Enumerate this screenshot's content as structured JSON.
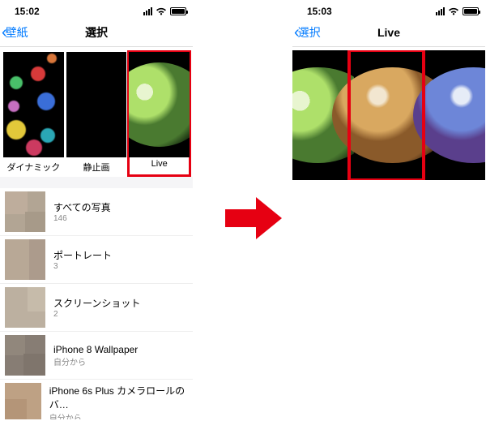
{
  "left": {
    "status_time": "15:02",
    "back_label": "壁紙",
    "title": "選択",
    "categories": [
      {
        "label": "ダイナミック"
      },
      {
        "label": "静止画"
      },
      {
        "label": "Live"
      }
    ],
    "albums": [
      {
        "name": "すべての写真",
        "count": "146"
      },
      {
        "name": "ポートレート",
        "count": "3"
      },
      {
        "name": "スクリーンショット",
        "count": "2"
      },
      {
        "name": "iPhone 8 Wallpaper",
        "count": "自分から"
      },
      {
        "name": "iPhone 6s Plus カメラロールのバ…",
        "count": "自分から"
      }
    ]
  },
  "right": {
    "status_time": "15:03",
    "back_label": "選択",
    "title": "Live"
  },
  "colors": {
    "highlight": "#e60012",
    "ios_blue": "#007aff"
  }
}
